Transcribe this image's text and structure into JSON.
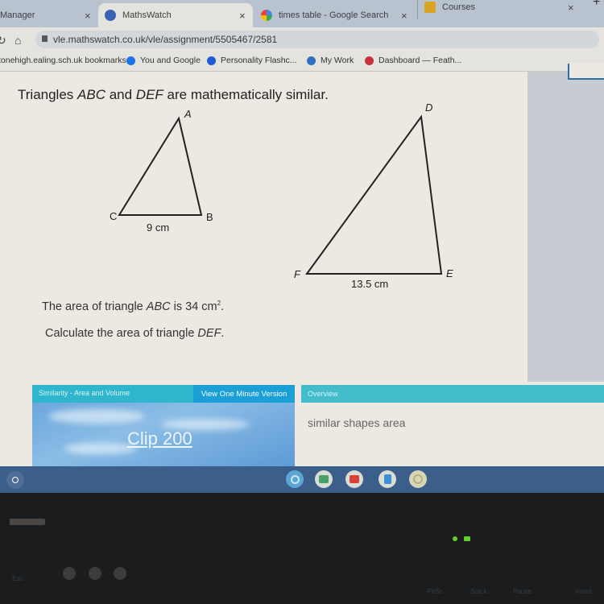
{
  "browser": {
    "tabs": [
      {
        "label": "Manager",
        "icon": "tab-icon",
        "active": false
      },
      {
        "label": "MathsWatch",
        "icon": "mathswatch-icon",
        "active": true
      },
      {
        "label": "times table - Google Search",
        "icon": "google-icon",
        "active": false
      },
      {
        "label": "Courses",
        "icon": "classroom-icon",
        "active": false
      }
    ],
    "close_glyph": "×",
    "new_tab_glyph": "+",
    "url": "vle.mathswatch.co.uk/vle/assignment/5505467/2581",
    "bookmarks": [
      {
        "label": "tonehigh.ealing.sch.uk bookmarks"
      },
      {
        "label": "You and Google"
      },
      {
        "label": "Personality Flashc..."
      },
      {
        "label": "My Work"
      },
      {
        "label": "Dashboard — Feath..."
      }
    ]
  },
  "question": {
    "title_pre": "Triangles ",
    "title_abc": "ABC",
    "title_mid": " and ",
    "title_def": "DEF",
    "title_post": " are mathematically similar.",
    "triangle_abc": {
      "labels": {
        "A": "A",
        "B": "B",
        "C": "C"
      },
      "side_cb": "9 cm"
    },
    "triangle_def": {
      "labels": {
        "D": "D",
        "E": "E",
        "F": "F"
      },
      "side_fe": "13.5 cm"
    },
    "line1_pre": "The area of triangle ",
    "line1_abc": "ABC",
    "line1_mid": " is 34 cm",
    "line1_sup": "2",
    "line1_post": ".",
    "line2_pre": "Calculate the area of triangle ",
    "line2_def": "DEF",
    "line2_post": "."
  },
  "video_panel": {
    "topic": "Similarity - Area and Volume",
    "one_minute_button": "View One Minute Version",
    "clip_link": "Clip 200",
    "overview_title": "Overview",
    "overview_text": "similar shapes area"
  },
  "shelf": {
    "apps": [
      "chrome-icon",
      "classroom-icon",
      "youtube-icon",
      "files-icon",
      "settings-icon"
    ]
  },
  "keyboard": {
    "keys": [
      "Esc",
      "PrtSc",
      "ScrLk",
      "Pause",
      "Insert"
    ]
  },
  "colors": {
    "header_teal": "#2fb6cc",
    "button_blue": "#1a9fd6",
    "shelf_blue": "#3c5e8a"
  }
}
